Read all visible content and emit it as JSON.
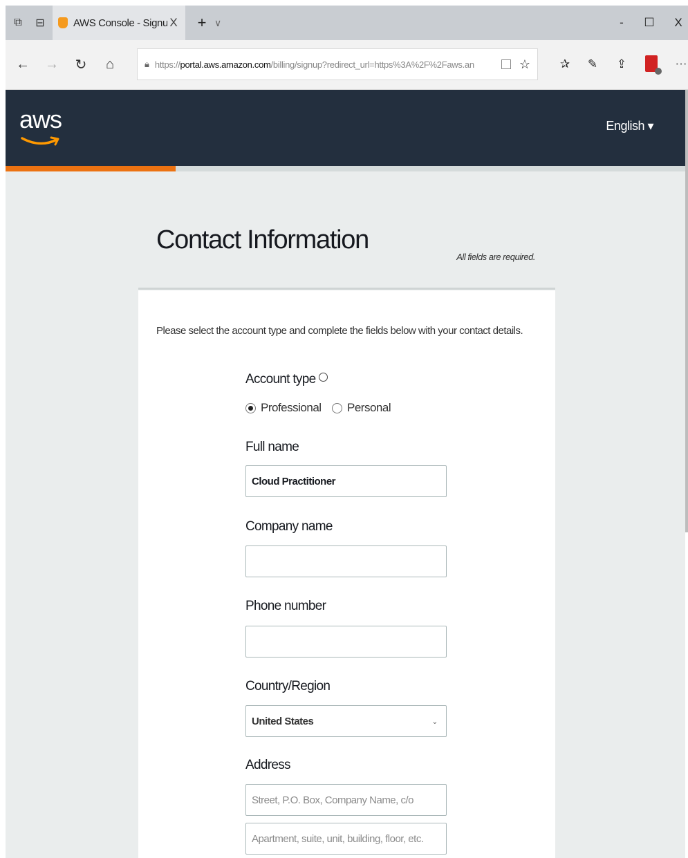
{
  "browser": {
    "tab_title": "AWS Console - Signup",
    "tab_close": "X",
    "new_tab": "+",
    "tab_list": "∨",
    "window_controls": {
      "minimize": "-",
      "maximize": "☐",
      "close": "X"
    },
    "url_prefix": "https://",
    "url_domain": "portal.aws.amazon.com",
    "url_rest": "/billing/signup?redirect_url=https%3A%2F%2Faws.an"
  },
  "header": {
    "logo_text": "aws",
    "language": "English ▾"
  },
  "progress": {
    "fraction": 0.25,
    "color": "#ec7211"
  },
  "form": {
    "title": "Contact Information",
    "required_note": "All fields are required.",
    "intro": "Please select the account type and complete the fields below with your contact details.",
    "account_type": {
      "label": "Account type",
      "options": [
        {
          "label": "Professional",
          "selected": true
        },
        {
          "label": "Personal",
          "selected": false
        }
      ]
    },
    "full_name": {
      "label": "Full name",
      "value": "Cloud Practitioner"
    },
    "company_name": {
      "label": "Company name",
      "value": ""
    },
    "phone_number": {
      "label": "Phone number",
      "value": ""
    },
    "country": {
      "label": "Country/Region",
      "value": "United States"
    },
    "address": {
      "label": "Address",
      "line1_placeholder": "Street, P.O. Box, Company Name, c/o",
      "line2_placeholder": "Apartment, suite, unit, building, floor, etc."
    }
  },
  "colors": {
    "aws_navy": "#232f3e",
    "aws_orange": "#ec7211",
    "page_bg": "#eaeded"
  }
}
